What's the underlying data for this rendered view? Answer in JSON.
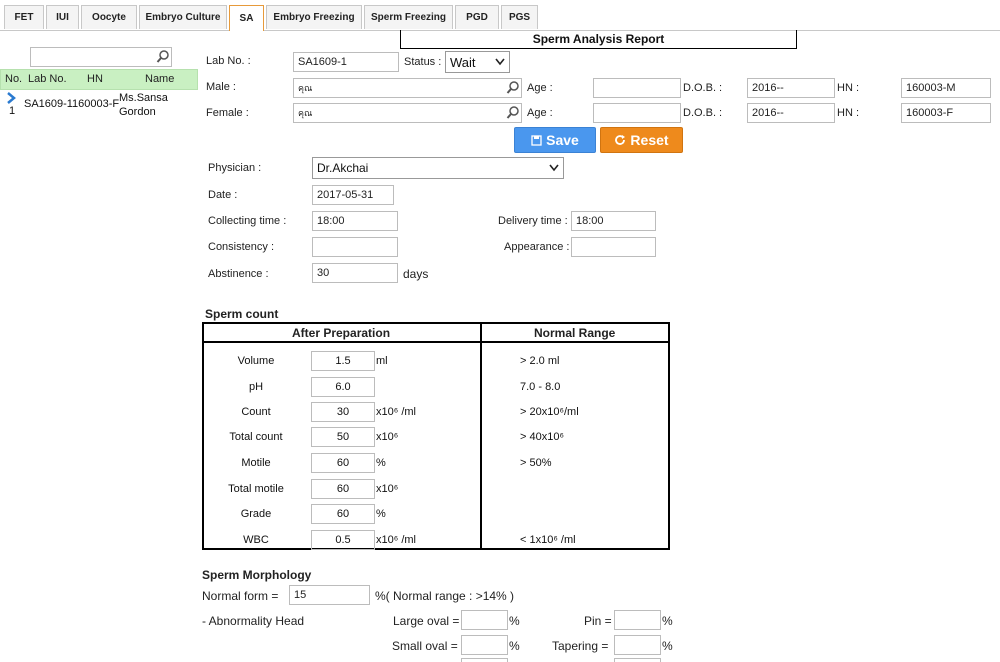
{
  "tabs": [
    "FET",
    "IUI",
    "Oocyte",
    "Embryo Culture",
    "SA",
    "Embryo Freezing",
    "Sperm Freezing",
    "PGD",
    "PGS"
  ],
  "report_title": "Sperm Analysis Report",
  "grid": {
    "headers": {
      "no": "No.",
      "lab_no": "Lab No.",
      "hn": "HN",
      "name": "Name"
    },
    "row": {
      "no": "1",
      "lab_no": "SA1609-1",
      "hn": "160003-F",
      "name_line1": "Ms.Sansa",
      "name_line2": "Gordon"
    }
  },
  "form": {
    "lab_no_label": "Lab No. :",
    "lab_no": "SA1609-1",
    "status_label": "Status :",
    "status": "Wait",
    "male_label": "Male :",
    "male_value": "คุณ",
    "female_label": "Female :",
    "female_value": "คุณ",
    "age_label": "Age :",
    "dob_label": "D.O.B. :",
    "hn_label": "HN :",
    "male_dob": "2016--",
    "male_hn": "160003-M",
    "female_dob": "2016--",
    "female_hn": "160003-F",
    "save": "Save",
    "reset": "Reset",
    "physician_label": "Physician :",
    "physician": "Dr.Akchai",
    "date_label": "Date :",
    "date": "2017-05-31",
    "collecting_label": "Collecting time :",
    "collecting": "18:00",
    "delivery_label": "Delivery time :",
    "delivery": "18:00",
    "consistency_label": "Consistency :",
    "appearance_label": "Appearance :",
    "abstinence_label": "Abstinence :",
    "abstinence": "30",
    "days": "days"
  },
  "sperm_count": {
    "title": "Sperm count",
    "col1": "After Preparation",
    "col2": "Normal Range",
    "rows": [
      {
        "label": "Volume",
        "value": "1.5",
        "unit": "ml",
        "range": "> 2.0 ml"
      },
      {
        "label": "pH",
        "value": "6.0",
        "unit": "",
        "range": "7.0 - 8.0"
      },
      {
        "label": "Count",
        "value": "30",
        "unit": "x10⁶ /ml",
        "range": "> 20x10⁶/ml"
      },
      {
        "label": "Total count",
        "value": "50",
        "unit": "x10⁶",
        "range": "> 40x10⁶"
      },
      {
        "label": "Motile",
        "value": "60",
        "unit": "%",
        "range": "> 50%"
      },
      {
        "label": "Total motile",
        "value": "60",
        "unit": "x10⁶",
        "range": ""
      },
      {
        "label": "Grade",
        "value": "60",
        "unit": "%",
        "range": ""
      },
      {
        "label": "WBC",
        "value": "0.5",
        "unit": "x10⁶ /ml",
        "range": "< 1x10⁶ /ml"
      }
    ]
  },
  "morphology": {
    "title": "Sperm Morphology",
    "normal_form_label": "Normal form =",
    "normal_form": "15",
    "normal_range": "%( Normal range : >14% )",
    "abn_head": "- Abnormality Head",
    "large_oval": "Large oval =",
    "small_oval": "Small oval =",
    "pin": "Pin =",
    "tapering": "Tapering =",
    "pct": "%"
  }
}
